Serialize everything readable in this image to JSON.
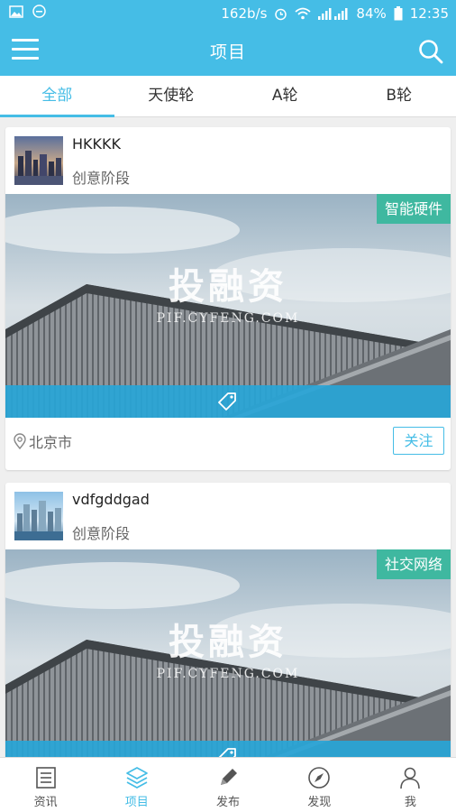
{
  "status_bar": {
    "speed": "162b/s",
    "battery": "84%",
    "time": "12:35",
    "icons": [
      "image-icon",
      "emoji-icon",
      "alarm-icon",
      "wifi-icon",
      "signal-icon",
      "battery-icon"
    ]
  },
  "header": {
    "title": "项目"
  },
  "tabs": [
    {
      "label": "全部",
      "active": true
    },
    {
      "label": "天使轮",
      "active": false
    },
    {
      "label": "A轮",
      "active": false
    },
    {
      "label": "B轮",
      "active": false
    }
  ],
  "projects": [
    {
      "name": "HKKKK",
      "stage": "创意阶段",
      "category": "智能硬件",
      "cover_text": "投融资",
      "cover_subtext": "PIF.CYFENG.COM",
      "location": "北京市",
      "follow_label": "关注"
    },
    {
      "name": "vdfgddgad",
      "stage": "创意阶段",
      "category": "社交网络",
      "cover_text": "投融资",
      "cover_subtext": "PIF.CYFENG.COM"
    }
  ],
  "bottom_nav": [
    {
      "label": "资讯",
      "icon": "news-icon",
      "active": false
    },
    {
      "label": "项目",
      "icon": "layers-icon",
      "active": true
    },
    {
      "label": "发布",
      "icon": "pencil-icon",
      "active": false
    },
    {
      "label": "发现",
      "icon": "compass-icon",
      "active": false
    },
    {
      "label": "我",
      "icon": "person-icon",
      "active": false
    }
  ],
  "colors": {
    "primary": "#45bde6",
    "tag": "#3fb8a0"
  }
}
